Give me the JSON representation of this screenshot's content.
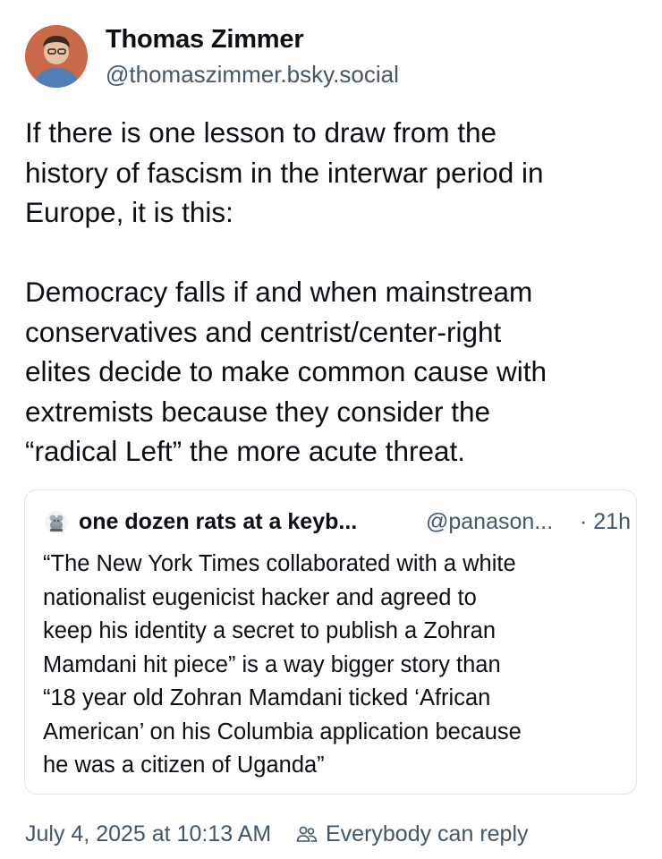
{
  "author": {
    "name": "Thomas Zimmer",
    "handle": "@thomaszimmer.bsky.social",
    "avatar_icon": "person-avatar-icon"
  },
  "post": {
    "paragraphs": [
      [
        "If there is one lesson to draw from the",
        "history of fascism in the interwar period in",
        "Europe, it is this:"
      ],
      [
        "Democracy falls if and when mainstream",
        "conservatives and centrist/center-right",
        "elites decide to make common cause with",
        "extremists because they consider the",
        "“radical Left” the more acute threat."
      ]
    ]
  },
  "quote": {
    "name": "one dozen rats at a keyb...",
    "handle": "@panason...",
    "time": "· 21h",
    "avatar_icon": "rat-avatar-icon",
    "lines": [
      "“The New York Times collaborated with a white",
      "nationalist eugenicist hacker and agreed to",
      "keep his identity a secret to publish a Zohran",
      "Mamdani hit piece” is a way bigger story than",
      "“18 year old Zohran Mamdani ticked ‘African",
      "American’ on his Columbia application because",
      "he was a citizen of Uganda”"
    ]
  },
  "footer": {
    "timestamp": "July 4, 2025 at 10:13 AM",
    "reply_setting": "Everybody can reply",
    "reply_icon": "people-icon"
  },
  "colors": {
    "text": "#0b0f14",
    "secondary": "#42576c",
    "border": "#e1e6eb",
    "avatar_bg": "#c86a4a"
  }
}
